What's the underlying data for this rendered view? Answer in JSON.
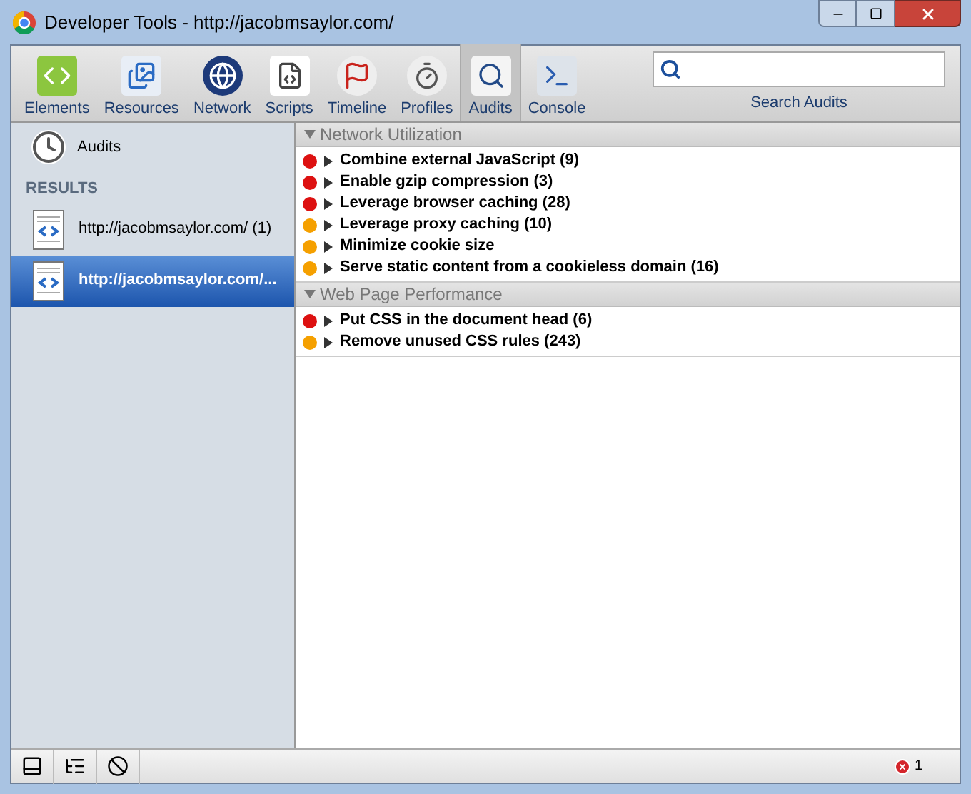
{
  "window": {
    "title": "Developer Tools - http://jacobmsaylor.com/"
  },
  "toolbar": [
    {
      "label": "Elements",
      "kind": "elements",
      "selected": false
    },
    {
      "label": "Resources",
      "kind": "resources",
      "selected": false
    },
    {
      "label": "Network",
      "kind": "network",
      "selected": false
    },
    {
      "label": "Scripts",
      "kind": "scripts",
      "selected": false
    },
    {
      "label": "Timeline",
      "kind": "timeline",
      "selected": false
    },
    {
      "label": "Profiles",
      "kind": "profiles",
      "selected": false
    },
    {
      "label": "Audits",
      "kind": "audits",
      "selected": true
    },
    {
      "label": "Console",
      "kind": "console",
      "selected": false
    }
  ],
  "search": {
    "label": "Search Audits"
  },
  "sidebar": {
    "audits_item": "Audits",
    "results_header": "RESULTS",
    "results": [
      {
        "label": "http://jacobmsaylor.com/ (1)",
        "selected": false
      },
      {
        "label": "http://jacobmsaylor.com/...",
        "selected": true
      }
    ]
  },
  "sections": [
    {
      "title": "Network Utilization",
      "expanded": true,
      "items": [
        {
          "label": "Combine external JavaScript (9)",
          "color": "#dd1111",
          "expanded": false
        },
        {
          "label": "Enable gzip compression (3)",
          "color": "#dd1111",
          "expanded": false
        },
        {
          "label": "Leverage browser caching (28)",
          "color": "#dd1111",
          "expanded": false
        },
        {
          "label": "Leverage proxy caching (10)",
          "color": "#f5a000",
          "expanded": false
        },
        {
          "label": "Minimize cookie size",
          "color": "#f5a000",
          "expanded": false
        },
        {
          "label": "Serve static content from a cookieless domain (16)",
          "color": "#f5a000",
          "expanded": false
        }
      ]
    },
    {
      "title": "Web Page Performance",
      "expanded": true,
      "items": [
        {
          "label": "Put CSS in the document head (6)",
          "color": "#dd1111",
          "expanded": false
        },
        {
          "label": "Remove unused CSS rules (243)",
          "color": "#f5a000",
          "expanded": false
        }
      ]
    }
  ],
  "status_bar": {
    "error_count": "1"
  }
}
